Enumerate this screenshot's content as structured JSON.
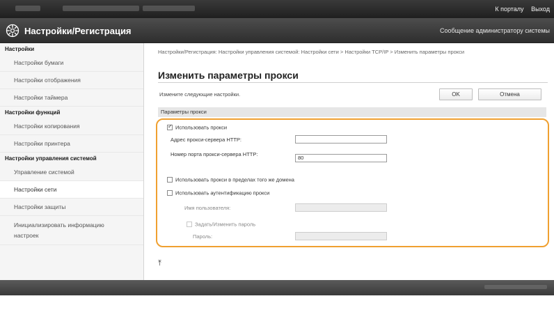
{
  "topbar": {
    "portal_link": "К порталу",
    "logout_link": "Выход"
  },
  "titlebar": {
    "icon": "settings-register-icon",
    "title": "Настройки/Регистрация",
    "admin_message": "Сообщение администратору системы"
  },
  "sidebar": {
    "sections": [
      {
        "title": "Настройки",
        "items": [
          "Настройки бумаги",
          "Настройки отображения",
          "Настройки таймера"
        ]
      },
      {
        "title": "Настройки функций",
        "items": [
          "Настройки копирования",
          "Настройки принтера"
        ]
      },
      {
        "title": "Настройки управления системой",
        "items": [
          "Управление системой",
          "Настройки сети",
          "Настройки защиты",
          "Инициализировать информацию настроек"
        ]
      }
    ],
    "active_item": "Настройки сети"
  },
  "main": {
    "breadcrumb": "Настройки/Регистрация: Настройки управления системой: Настройки сети > Настройки TCP/IP > Изменить параметры прокси",
    "page_title": "Изменить параметры прокси",
    "instruction": "Измените следующие настройки.",
    "ok_button": "OK",
    "cancel_button": "Отмена",
    "section_header": "Параметры прокси",
    "use_proxy": {
      "label": "Использовать прокси",
      "checked": true
    },
    "http_proxy_address": {
      "label": "Адрес прокси-сервера HTTP:",
      "value": ""
    },
    "http_proxy_port": {
      "label": "Номер порта прокси-сервера HTTP:",
      "value": "80"
    },
    "same_domain": {
      "label": "Использовать прокси в пределах того же домена",
      "checked": false
    },
    "proxy_auth": {
      "label": "Использовать аутентификацию прокси",
      "checked": false
    },
    "username": {
      "label": "Имя пользователя:",
      "value": ""
    },
    "set_password": {
      "label": "Задать/Изменить пароль",
      "checked": false
    },
    "password": {
      "label": "Пароль:",
      "value": ""
    },
    "to_top_icon": "arrow-to-top-icon"
  },
  "colors": {
    "highlight": "#f0a030",
    "topbar": "#2a2a2a"
  }
}
